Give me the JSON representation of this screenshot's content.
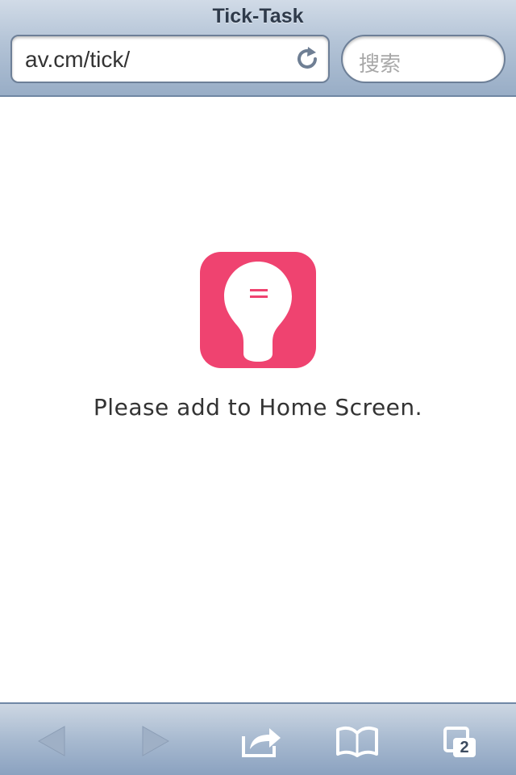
{
  "browser": {
    "title": "Tick-Task",
    "url": "av.cm/tick/",
    "search_placeholder": "搜索"
  },
  "content": {
    "icon_name": "lightbulb-app-icon",
    "icon_color": "#ef4370",
    "message": "Please add to Home Screen."
  },
  "toolbar": {
    "back_icon": "back-arrow-icon",
    "forward_icon": "forward-arrow-icon",
    "share_icon": "share-icon",
    "bookmarks_icon": "bookmarks-icon",
    "tabs_icon": "tabs-icon",
    "tab_count": "2"
  }
}
